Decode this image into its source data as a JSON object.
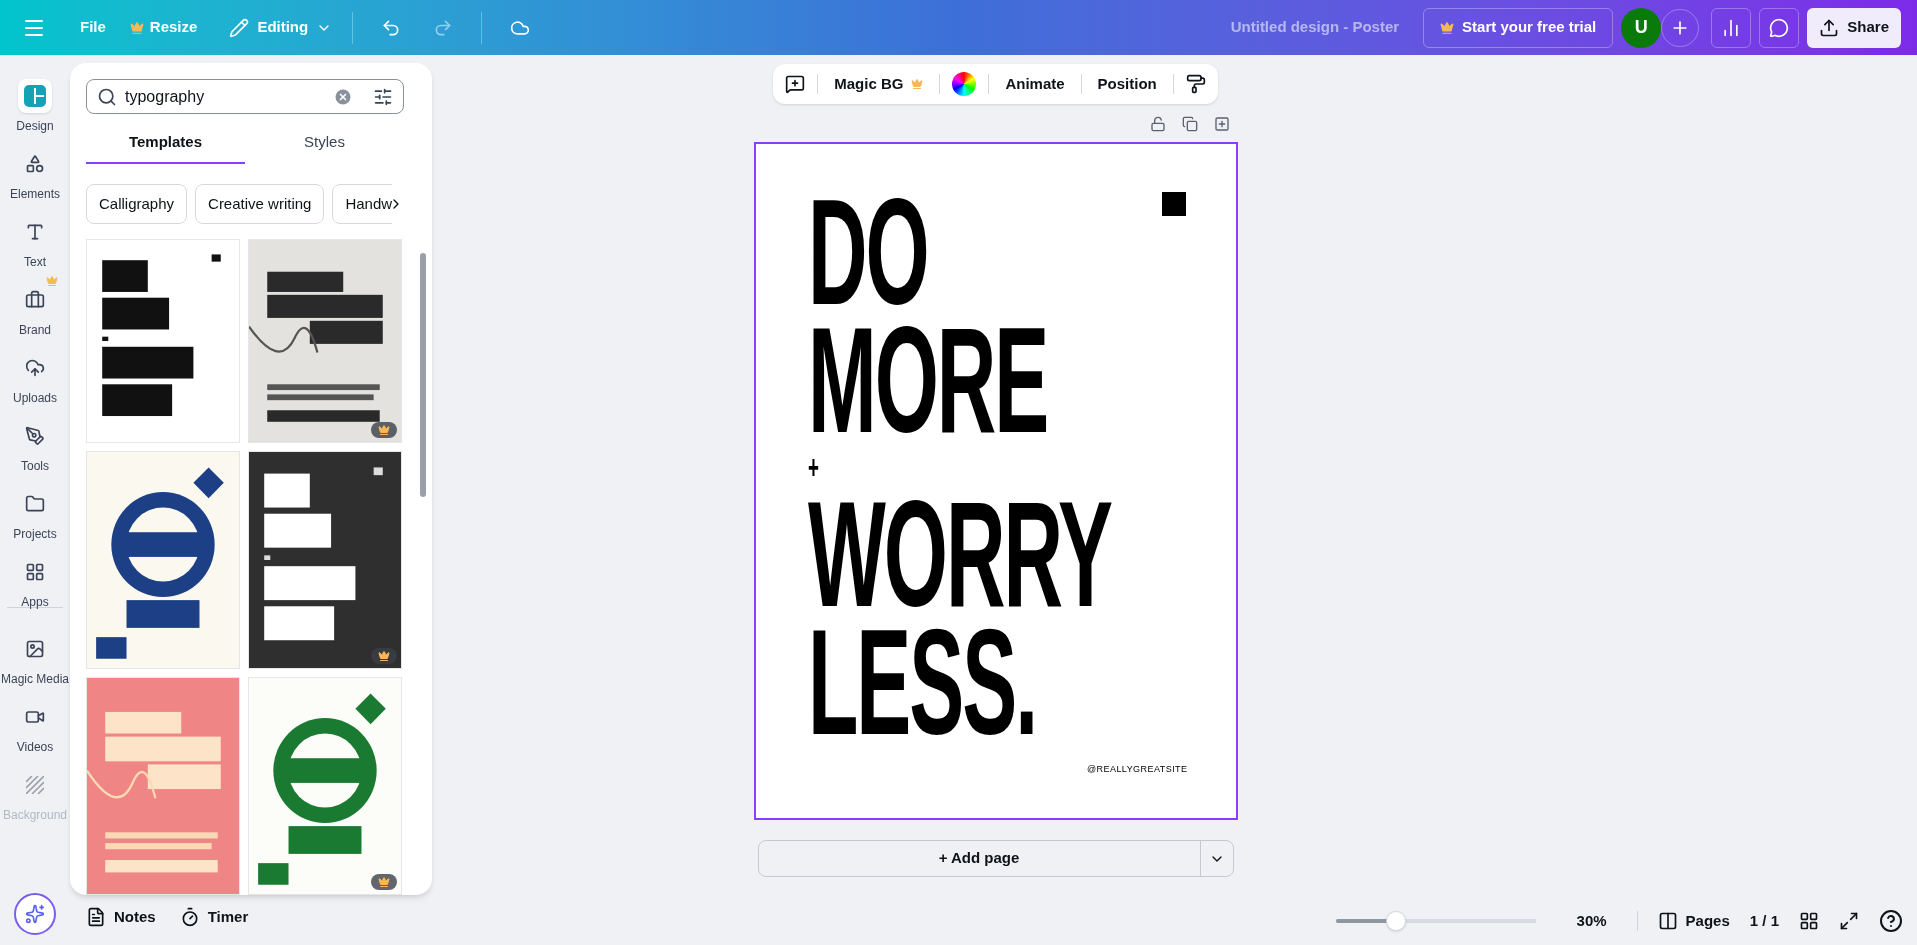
{
  "topbar": {
    "menu": [
      {
        "label": "File",
        "crown": false
      },
      {
        "label": "Resize",
        "crown": true
      }
    ],
    "mode": "Editing",
    "doc_title": "Untitled design - Poster",
    "trial": "Start your free trial",
    "avatar": "U",
    "share": "Share"
  },
  "sidebar": {
    "items": [
      {
        "label": "Design",
        "selected": true,
        "crown": false,
        "disabled": false,
        "kind": "design"
      },
      {
        "label": "Elements",
        "selected": false,
        "crown": false,
        "disabled": false,
        "kind": "elements"
      },
      {
        "label": "Text",
        "selected": false,
        "crown": false,
        "disabled": false,
        "kind": "text"
      },
      {
        "label": "Brand",
        "selected": false,
        "crown": true,
        "disabled": false,
        "kind": "brand"
      },
      {
        "label": "Uploads",
        "selected": false,
        "crown": false,
        "disabled": false,
        "kind": "uploads"
      },
      {
        "label": "Tools",
        "selected": false,
        "crown": false,
        "disabled": false,
        "kind": "tools"
      },
      {
        "label": "Projects",
        "selected": false,
        "crown": false,
        "disabled": false,
        "kind": "projects"
      },
      {
        "label": "Apps",
        "selected": false,
        "crown": false,
        "disabled": false,
        "kind": "apps"
      },
      {
        "label": "Magic Media",
        "selected": false,
        "crown": false,
        "disabled": false,
        "kind": "media"
      },
      {
        "label": "Videos",
        "selected": false,
        "crown": false,
        "disabled": false,
        "kind": "videos"
      },
      {
        "label": "Background",
        "selected": false,
        "crown": false,
        "disabled": true,
        "kind": "background"
      }
    ]
  },
  "panel": {
    "search": {
      "value": "typography"
    },
    "tabs": [
      {
        "label": "Templates",
        "selected": true
      },
      {
        "label": "Styles",
        "selected": false
      }
    ],
    "chips": [
      "Calligraphy",
      "Creative writing",
      "Handw"
    ],
    "templates": [
      {
        "kind": "picture",
        "premium": false
      },
      {
        "kind": "picture",
        "premium": true
      },
      {
        "kind": "picture",
        "premium": false
      },
      {
        "kind": "picture",
        "premium": true
      },
      {
        "kind": "picture",
        "premium": false
      },
      {
        "kind": "picture",
        "premium": true
      }
    ]
  },
  "toolbar": {
    "magic_bg": {
      "label": "Magic BG",
      "crown": true
    },
    "animate": "Animate",
    "position": "Position"
  },
  "design": {
    "lines": [
      "DO",
      "MORE",
      "+",
      "WORRY",
      "LESS."
    ],
    "handle": "@REALLYGREATSITE"
  },
  "add_page": "+ Add page",
  "bottom": {
    "notes": "Notes",
    "timer": "Timer",
    "zoom": {
      "level": 0.3,
      "reading": "30%"
    },
    "pages": "Pages",
    "page_count": "1 / 1"
  }
}
